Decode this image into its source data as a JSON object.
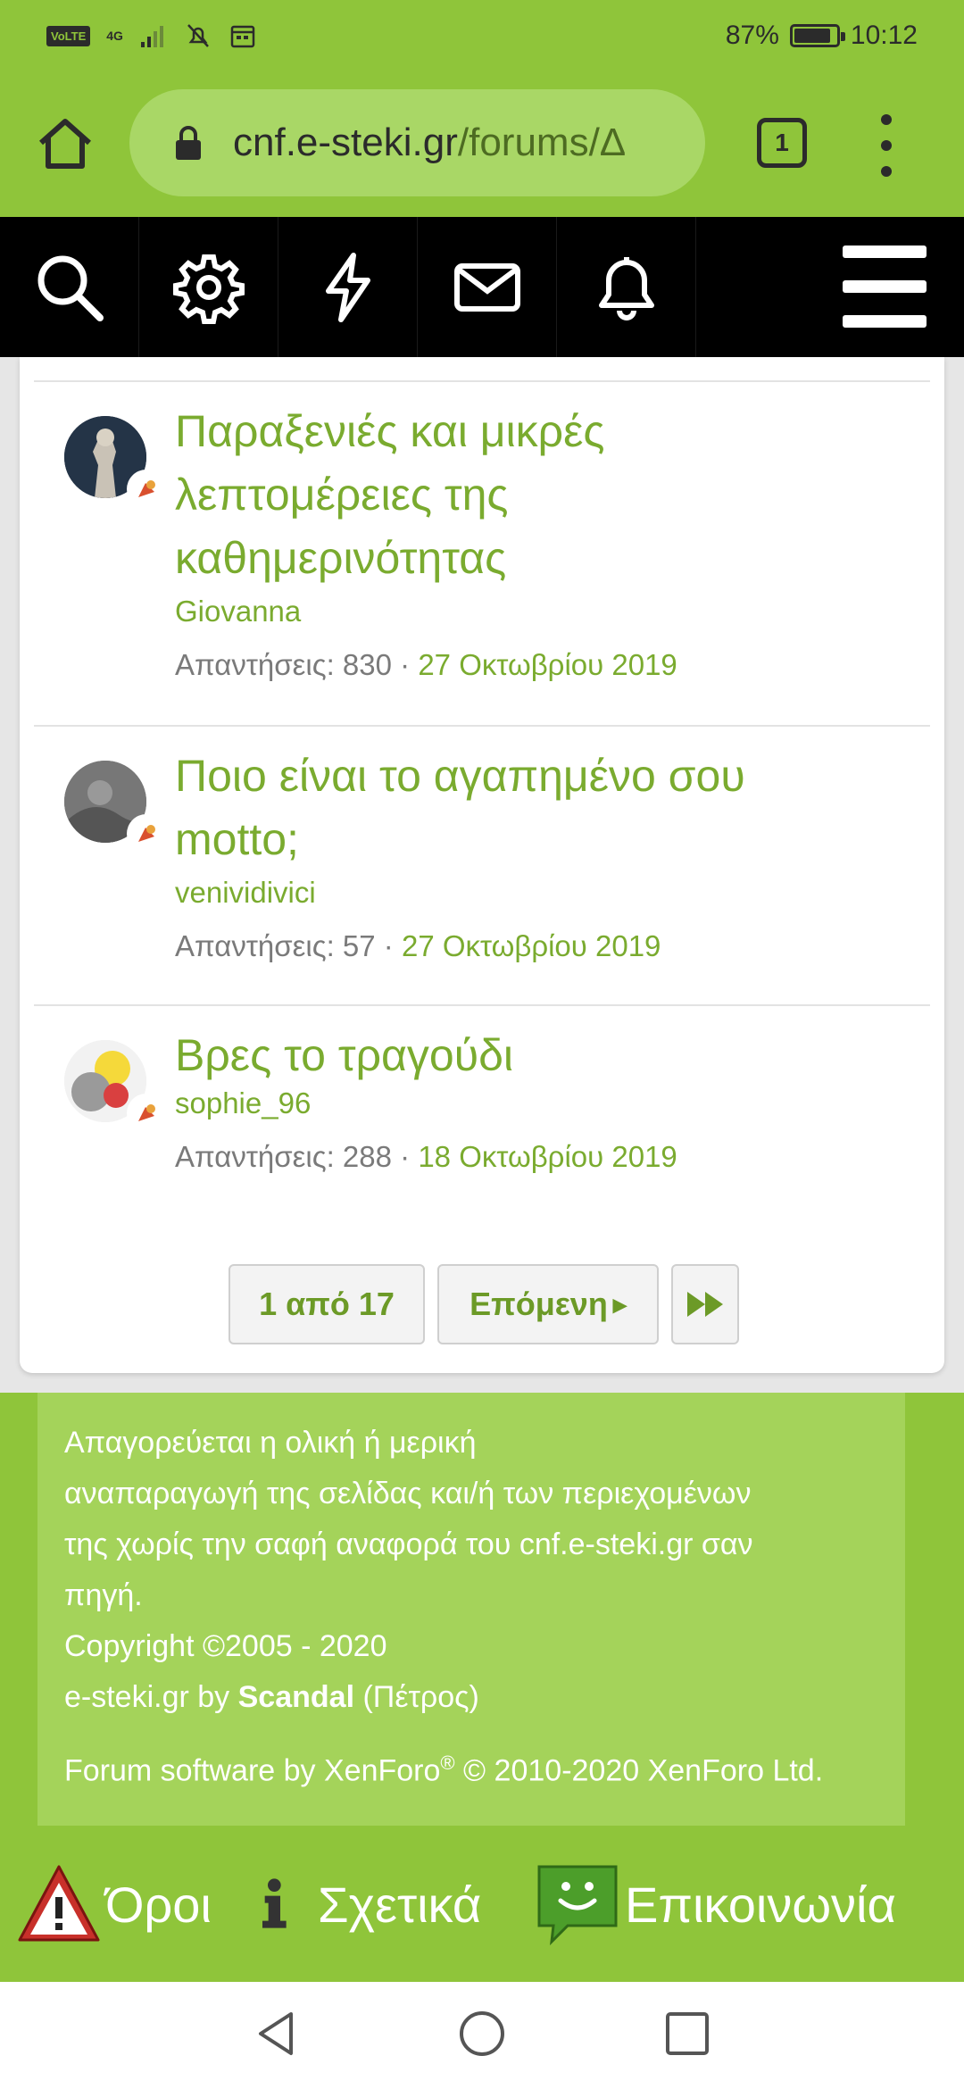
{
  "status_bar": {
    "network_chip": "VoLTE",
    "signal_label": "4G",
    "battery_percent": "87%",
    "battery_level": 0.87,
    "time": "10:12"
  },
  "browser": {
    "url_domain": "cnf.e-steki.gr",
    "url_path": "/forums/Δ",
    "tab_count": "1",
    "home_icon": "home-icon",
    "lock_icon": "lock-icon",
    "menu_icon": "more-vert-icon"
  },
  "forum_nav": {
    "icons": [
      "search-icon",
      "gear-icon",
      "lightning-icon",
      "envelope-icon",
      "bell-icon",
      "hamburger-icon"
    ]
  },
  "threads": [
    {
      "title_line1": "Παραξενιές και μικρές",
      "title_line2": "λεπτομέρειες της",
      "title_line3": "καθημερινότητας",
      "author": "Giovanna",
      "replies_label": "Απαντήσεις: 830 · ",
      "date": "27 Οκτωβρίου 2019"
    },
    {
      "title_line1": "Ποιο είναι το αγαπημένο σου",
      "title_line2": "motto;",
      "author": "venividivici",
      "replies_label": "Απαντήσεις: 57 · ",
      "date": "27 Οκτωβρίου 2019"
    },
    {
      "title_line1": "Βρες το τραγούδι",
      "author": "sophie_96",
      "replies_label": "Απαντήσεις: 288 · ",
      "date": "18 Οκτωβρίου 2019"
    }
  ],
  "pagination": {
    "page_label": "1 από 17",
    "next_label": "Επόμενη",
    "next_arrow": "▸",
    "last_icon": "fast-forward-icon"
  },
  "footer": {
    "notice_line1": "Απαγορεύεται η ολική ή μερική",
    "notice_line2": "αναπαραγωγή της σελίδας και/ή των περιεχομένων",
    "notice_line3": "της χωρίς την σαφή αναφορά του cnf.e-steki.gr σαν",
    "notice_line4": "πηγή.",
    "copyright": "Copyright ©2005 - 2020",
    "by_prefix": "e-steki.gr by ",
    "by_name": "Scandal",
    "by_suffix": " (Πέτρος)",
    "software_prefix": "Forum software by XenForo",
    "software_reg": "®",
    "software_suffix": " © 2010-2020 XenForo Ltd."
  },
  "footer_links": {
    "terms": "Όροι",
    "about": "Σχετικά",
    "contact": "Επικοινωνία"
  },
  "colors": {
    "accent_green": "#8fc53a",
    "link_green": "#7aab2f",
    "nav_black": "#000000"
  }
}
